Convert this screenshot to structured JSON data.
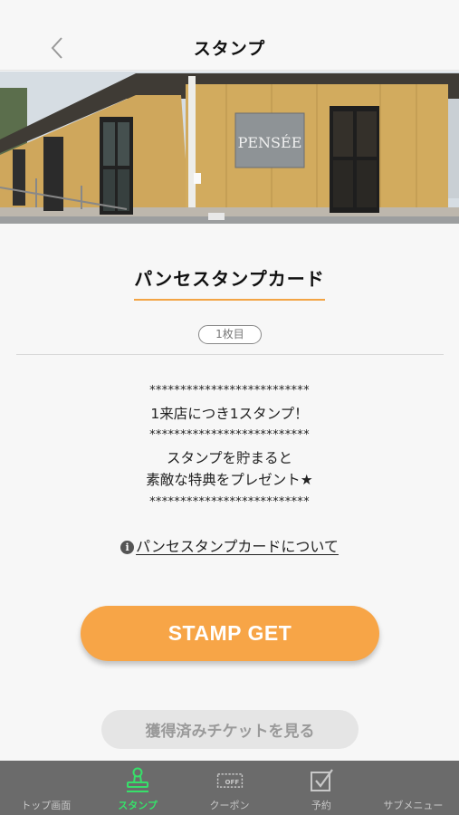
{
  "header": {
    "title": "スタンプ",
    "back_icon": "chevron-left-icon"
  },
  "hero": {
    "signboard_text": "PENSÉE"
  },
  "card": {
    "title": "パンセスタンプカード",
    "sheet_badge": "1枚目"
  },
  "description": {
    "lines": [
      "**************************",
      "1来店につき1スタンプ！",
      "**************************",
      "スタンプを貯まると",
      "素敵な特典をプレゼント★",
      "**************************"
    ]
  },
  "about_link": {
    "icon": "info-icon",
    "label": "パンセスタンプカードについて"
  },
  "buttons": {
    "stamp_get": "STAMP GET",
    "view_tickets": "獲得済みチケットを見る"
  },
  "tabbar": {
    "active_color": "#37e06a",
    "items": [
      {
        "label": "トップ画面",
        "icon": "home-icon"
      },
      {
        "label": "スタンプ",
        "icon": "stamp-icon"
      },
      {
        "label": "クーポン",
        "icon": "coupon-off-icon",
        "icon_text": "OFF"
      },
      {
        "label": "予約",
        "icon": "reservation-check-icon"
      },
      {
        "label": "サブメニュー",
        "icon": "menu-icon"
      }
    ]
  },
  "colors": {
    "accent_orange": "#f7a547",
    "title_underline": "#f3a444",
    "tabbar_bg": "#6b6b6b"
  }
}
